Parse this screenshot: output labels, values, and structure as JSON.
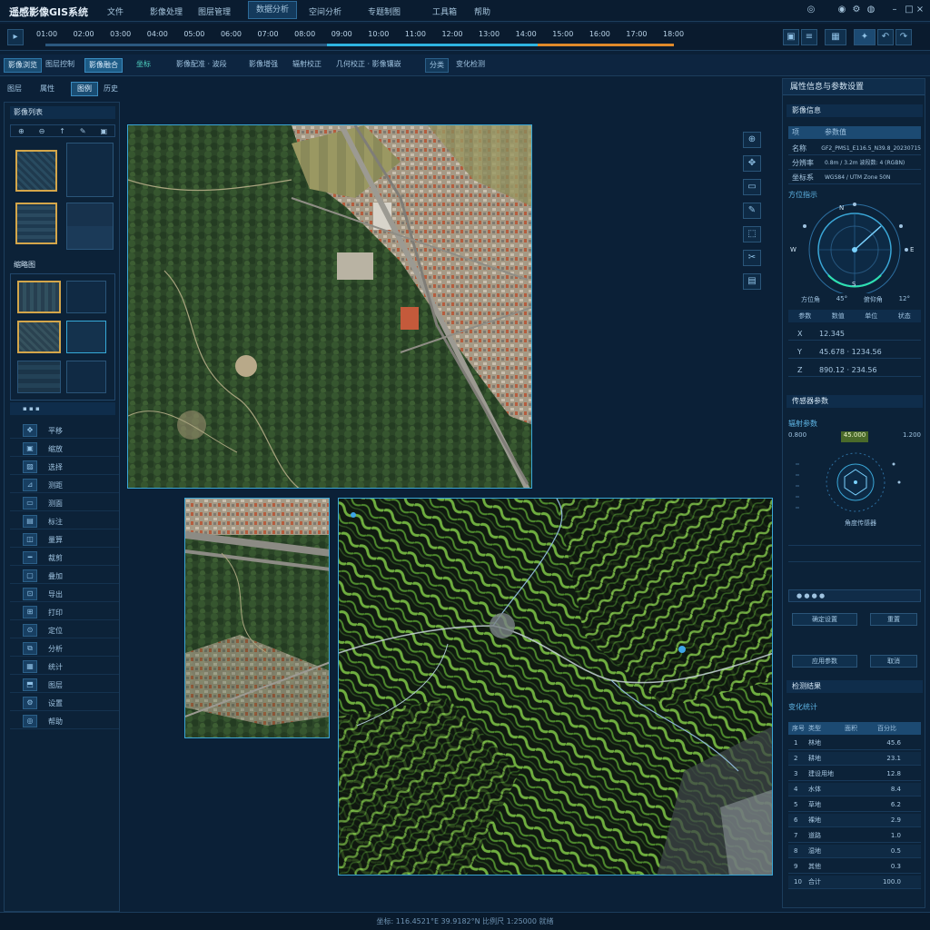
{
  "app": {
    "title": "遥感影像GIS系统"
  },
  "menu": {
    "items": [
      "文件",
      "影像处理",
      "图层管理",
      "数据分析",
      "空间分析",
      "专题制图",
      "工具箱",
      "帮助"
    ],
    "active_index": 3,
    "window_icons": [
      "user-icon",
      "bell-icon",
      "settings-icon",
      "minimize-icon",
      "maximize-icon",
      "close-icon"
    ]
  },
  "timeline": {
    "ticks": [
      "01:00",
      "02:00",
      "03:00",
      "04:00",
      "05:00",
      "06:00",
      "07:00",
      "08:00",
      "09:00",
      "10:00",
      "11:00",
      "12:00",
      "13:00",
      "14:00",
      "15:00",
      "16:00",
      "17:00",
      "18:00"
    ],
    "progress_fraction": 0.76,
    "controls": [
      "play-icon",
      "camera-icon",
      "layers-icon",
      "grid-icon",
      "back-icon",
      "forward-icon"
    ]
  },
  "toolbar": {
    "buttons": [
      "影像浏览",
      "图层控制",
      "影像融合",
      "坐标",
      "影像配准 · 波段",
      "影像增强",
      "辐射校正",
      "几何校正 · 影像镶嵌",
      "分类",
      "变化检测"
    ],
    "selected_index": 2
  },
  "left": {
    "tabs": [
      "图层",
      "属性",
      "图例",
      "历史"
    ],
    "selected_tab": 2,
    "section1": "影像列表",
    "section2": "缩略图",
    "tools": [
      "平移",
      "缩放",
      "选择",
      "测距",
      "测面",
      "标注",
      "量算",
      "裁剪",
      "叠加",
      "导出",
      "打印",
      "定位",
      "分析",
      "统计",
      "图层",
      "设置",
      "帮助"
    ]
  },
  "side_tools": [
    "zoom-in-icon",
    "pan-icon",
    "measure-icon",
    "draw-icon",
    "select-icon",
    "erase-icon",
    "layers-icon"
  ],
  "right": {
    "title": "属性信息与参数设置",
    "sec1": "影像信息",
    "props": [
      {
        "k": "名称",
        "v": "GF2_PMS1_E116.5_N39.8_20230715"
      },
      {
        "k": "分辨率",
        "v": "0.8m / 3.2m  波段数: 4  (RGBN)"
      },
      {
        "k": "坐标系",
        "v": "WGS84 / UTM Zone 50N"
      }
    ],
    "sec2": "方位指示",
    "compass_labels": [
      "N",
      "E",
      "S",
      "W"
    ],
    "compass_readout": [
      "方位角",
      "45°",
      "俯仰角",
      "12°"
    ],
    "sec2_rows": [
      {
        "k": "X",
        "v": "12.345"
      },
      {
        "k": "Y",
        "v": "45.678 · 1234.56"
      },
      {
        "k": "Z",
        "v": "890.12 · 234.56"
      }
    ],
    "sec3": "传感器参数",
    "sensor_title": "辐射参数",
    "sensor_vals": [
      "0.800",
      "45.000",
      "1.200"
    ],
    "sensor_caption": "角度传感器",
    "sensor_btns": [
      "确定设置",
      "重置",
      "应用参数",
      "取消"
    ],
    "sec4": "检测结果",
    "sec4_sub": "变化统计",
    "table_header": [
      "序号",
      "类型",
      "面积",
      "百分比"
    ],
    "table_rows": [
      [
        "1",
        "林地",
        "45.6"
      ],
      [
        "2",
        "耕地",
        "23.1"
      ],
      [
        "3",
        "建设用地",
        "12.8"
      ],
      [
        "4",
        "水体",
        "8.4"
      ],
      [
        "5",
        "草地",
        "6.2"
      ],
      [
        "6",
        "裸地",
        "2.9"
      ],
      [
        "7",
        "道路",
        "1.0"
      ],
      [
        "8",
        "湿地",
        "0.5"
      ],
      [
        "9",
        "其他",
        "0.3"
      ],
      [
        "10",
        "合计",
        "100.0"
      ]
    ]
  },
  "status": "坐标: 116.4521°E 39.9182°N   比例尺 1:25000   就绪"
}
